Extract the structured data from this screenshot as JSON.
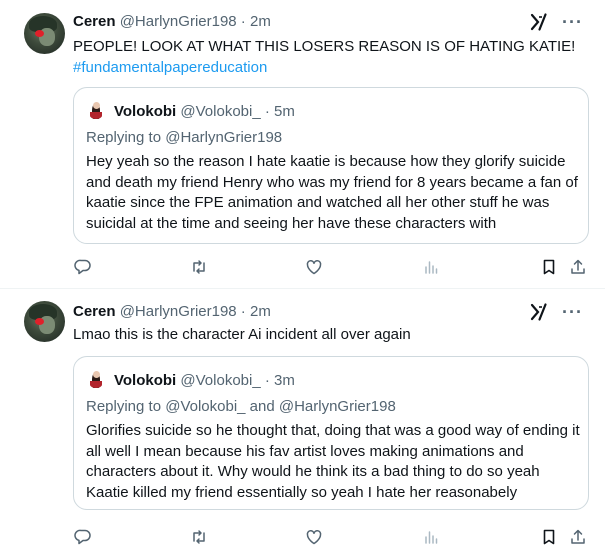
{
  "tweets": [
    {
      "author": {
        "name": "Ceren",
        "handle": "@HarlynGrier198",
        "time": "2m"
      },
      "text": "PEOPLE! LOOK AT WHAT THIS LOSERS REASON IS OF HATING KATIE!",
      "hashtag": "#fundamentalpapereducation",
      "quote": {
        "author": {
          "name": "Volokobi",
          "handle": "@Volokobi_",
          "time": "5m"
        },
        "replying_prefix": "Replying to ",
        "replying_to": "@HarlynGrier198",
        "text": "Hey yeah so the reason I hate kaatie is because how they glorify suicide and death my friend Henry who was my friend for 8 years became a fan of kaatie since the FPE animation and watched all her other stuff he was suicidal at the time and seeing her have these characters with"
      }
    },
    {
      "author": {
        "name": "Ceren",
        "handle": "@HarlynGrier198",
        "time": "2m"
      },
      "text": "Lmao this is the character Ai incident all over again",
      "quote": {
        "author": {
          "name": "Volokobi",
          "handle": "@Volokobi_",
          "time": "3m"
        },
        "replying_prefix": "Replying to ",
        "replying_to": "@Volokobi_ and @HarlynGrier198",
        "text": "Glorifies suicide so he thought that, doing that was a good way of ending it all well I mean because his fav artist loves making animations and characters about it. Why would he think its a bad thing to do so yeah Kaatie killed my friend essentially so yeah I hate her reasonabely"
      }
    }
  ],
  "ui": {
    "separator_dot": " · ",
    "more_glyph": "···",
    "icons": [
      "grok-icon",
      "more-icon",
      "reply-icon",
      "retweet-icon",
      "like-icon",
      "views-icon",
      "bookmark-icon",
      "share-icon"
    ],
    "colors": {
      "text": "#0f1419",
      "muted": "#536471",
      "link": "#1d9bf0",
      "border": "#cfd9de"
    }
  }
}
